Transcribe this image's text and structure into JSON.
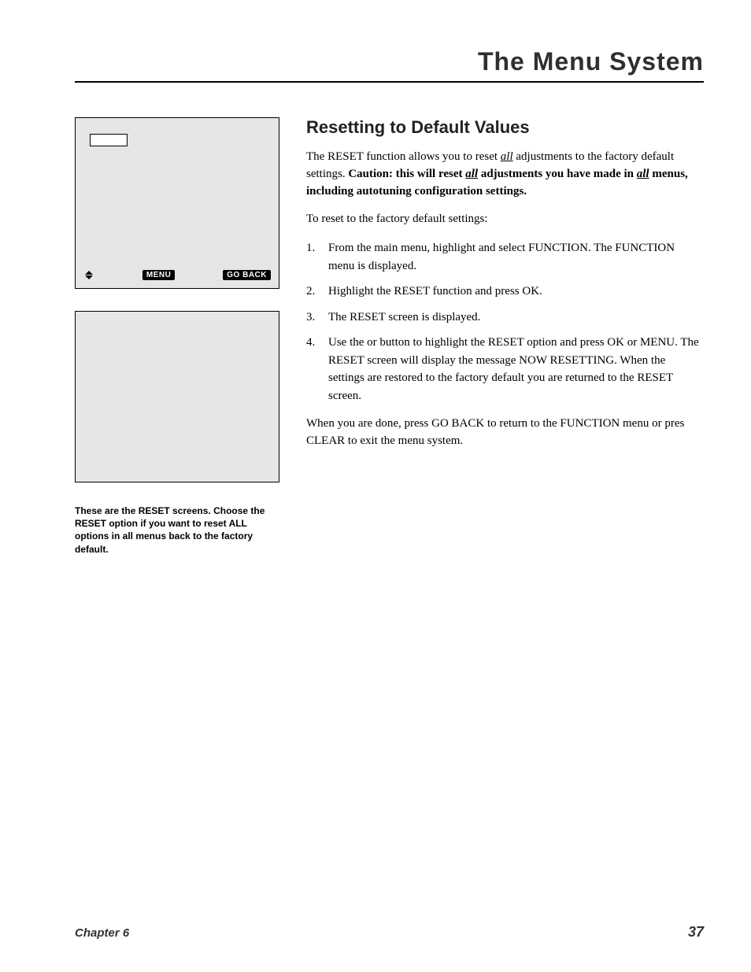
{
  "header": {
    "title": "The Menu System"
  },
  "left": {
    "bottom_bar": {
      "menu": "MENU",
      "goback": "GO BACK"
    },
    "caption": "These are the RESET screens. Choose the RESET option if you want to reset ALL options in all menus back to the factory default."
  },
  "right": {
    "section_title": "Resetting to Default Values",
    "intro_pre": "The RESET function allows you to reset ",
    "intro_all": "all",
    "intro_post": " adjustments to the factory default settings. ",
    "caution_pre": "Caution: this will reset ",
    "caution_all": "all",
    "caution_post": " adjustments you have made in ",
    "caution_all2": "all",
    "caution_post2": " menus, including autotuning configuration settings.",
    "lead": "To reset to the factory default settings:",
    "steps": [
      "From the main menu, highlight and select FUNCTION. The FUNCTION menu is displayed.",
      "Highlight the RESET function and press OK.",
      "The RESET screen is displayed.",
      "Use the    or    button to highlight the RESET option and press OK or MENU. The RESET screen will display the message NOW RESETTING. When the settings are restored to the factory default you are returned to the RESET screen."
    ],
    "outro": "When you are done, press GO BACK to return to the FUNCTION menu or pres CLEAR to exit the menu system."
  },
  "footer": {
    "chapter": "Chapter 6",
    "page": "37"
  }
}
